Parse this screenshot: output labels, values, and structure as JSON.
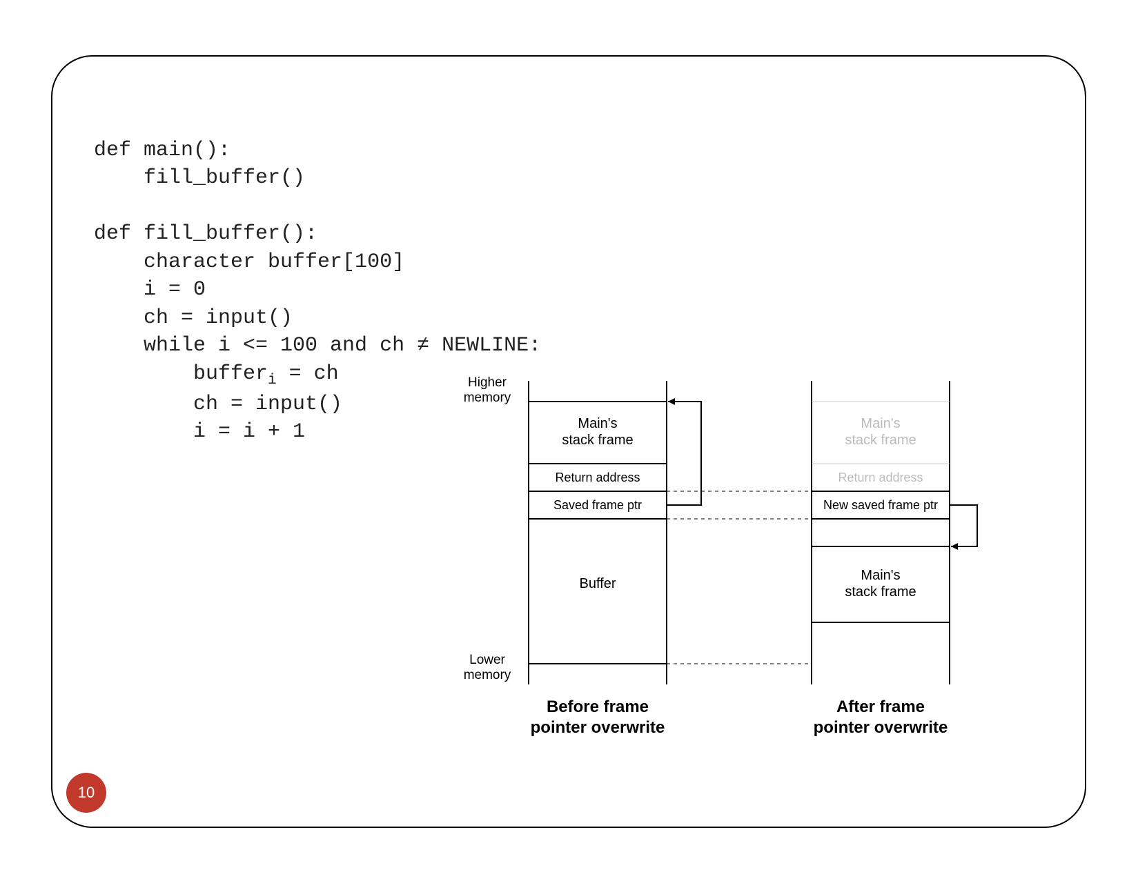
{
  "page_number": "10",
  "code": {
    "l1": "def main():",
    "l2": "    fill_buffer()",
    "l3": "",
    "l4": "def fill_buffer():",
    "l5": "    character buffer[100]",
    "l6": "    i = 0",
    "l7": "    ch = input()",
    "l8": "    while i <= 100 and ch ≠ NEWLINE:",
    "l9a": "        buffer",
    "l9b": "i",
    "l9c": " = ch",
    "l10": "        ch = input()",
    "l11": "        i = i + 1"
  },
  "memory": {
    "higher": "Higher",
    "higher2": "memory",
    "lower": "Lower",
    "lower2": "memory"
  },
  "before": {
    "caption1": "Before frame",
    "caption2": "pointer overwrite",
    "cell_main1": "Main's",
    "cell_main2": "stack frame",
    "cell_ret": "Return address",
    "cell_sfp": "Saved frame ptr",
    "cell_buf": "Buffer"
  },
  "after": {
    "caption1": "After frame",
    "caption2": "pointer overwrite",
    "ghost_main1": "Main's",
    "ghost_main2": "stack frame",
    "ghost_ret": "Return address",
    "cell_nsfp": "New saved frame ptr",
    "cell_main1": "Main's",
    "cell_main2": "stack frame"
  }
}
